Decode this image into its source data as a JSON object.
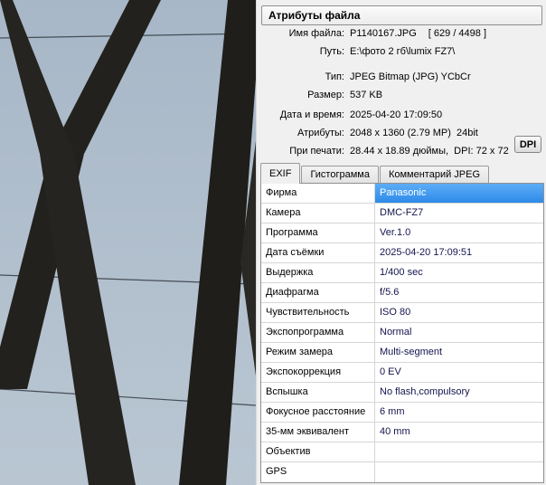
{
  "photo": {
    "alt": "Dark diagonal metal beams and thin power lines photographed against an overcast blue-grey sky",
    "sky_top": "#a7b7c7",
    "sky_bottom": "#b9c6d2",
    "beam_color": "#211f1c",
    "wire_color": "#454d55"
  },
  "panel": {
    "title": "Атрибуты файла",
    "info": [
      {
        "label": "Имя файла:",
        "value": "P1140167.JPG",
        "extra": "[ 629 / 4498 ]"
      },
      {
        "label": "Путь:",
        "value": "E:\\фото 2 гб\\lumix FZ7\\",
        "extra": ""
      },
      {
        "label": "Тип:",
        "value": "JPEG Bitmap (JPG) YCbCr",
        "extra": ""
      },
      {
        "label": "Размер:",
        "value": "537 KB",
        "extra": ""
      },
      {
        "label": "Дата и время:",
        "value": "2025-04-20 17:09:50",
        "extra": ""
      },
      {
        "label": "Атрибуты:",
        "value": "2048 x 1360 (2.79 MP)  24bit",
        "extra": ""
      },
      {
        "label": "При печати:",
        "value": "28.44 x 18.89 дюймы,  DPI: 72 x 72",
        "extra": ""
      }
    ],
    "dpi_button_label": "DPI",
    "tabs": [
      "EXIF",
      "Гистограмма",
      "Комментарий JPEG"
    ],
    "active_tab": "EXIF",
    "exif_rows": [
      {
        "label": "Фирма",
        "value": "Panasonic",
        "selected": true
      },
      {
        "label": "Камера",
        "value": "DMC-FZ7",
        "selected": false
      },
      {
        "label": "Программа",
        "value": "Ver.1.0",
        "selected": false
      },
      {
        "label": "Дата съёмки",
        "value": "2025-04-20 17:09:51",
        "selected": false
      },
      {
        "label": "Выдержка",
        "value": "1/400 sec",
        "selected": false
      },
      {
        "label": "Диафрагма",
        "value": "f/5.6",
        "selected": false
      },
      {
        "label": "Чувствительность",
        "value": "ISO 80",
        "selected": false
      },
      {
        "label": "Экспопрограмма",
        "value": "Normal",
        "selected": false
      },
      {
        "label": "Режим замера",
        "value": "Multi-segment",
        "selected": false
      },
      {
        "label": "Экспокоррекция",
        "value": "0 EV",
        "selected": false
      },
      {
        "label": "Вспышка",
        "value": "No flash,compulsory",
        "selected": false
      },
      {
        "label": "Фокусное расстояние",
        "value": "6 mm",
        "selected": false
      },
      {
        "label": "35-мм эквивалент",
        "value": "40 mm",
        "selected": false
      },
      {
        "label": "Объектив",
        "value": "",
        "selected": false
      },
      {
        "label": "GPS",
        "value": "",
        "selected": false
      }
    ],
    "colors": {
      "selection_blue_top": "#5cadf6",
      "selection_blue_bottom": "#2e8be9",
      "value_text": "#14144e",
      "panel_bg": "#f0f0f0"
    }
  }
}
